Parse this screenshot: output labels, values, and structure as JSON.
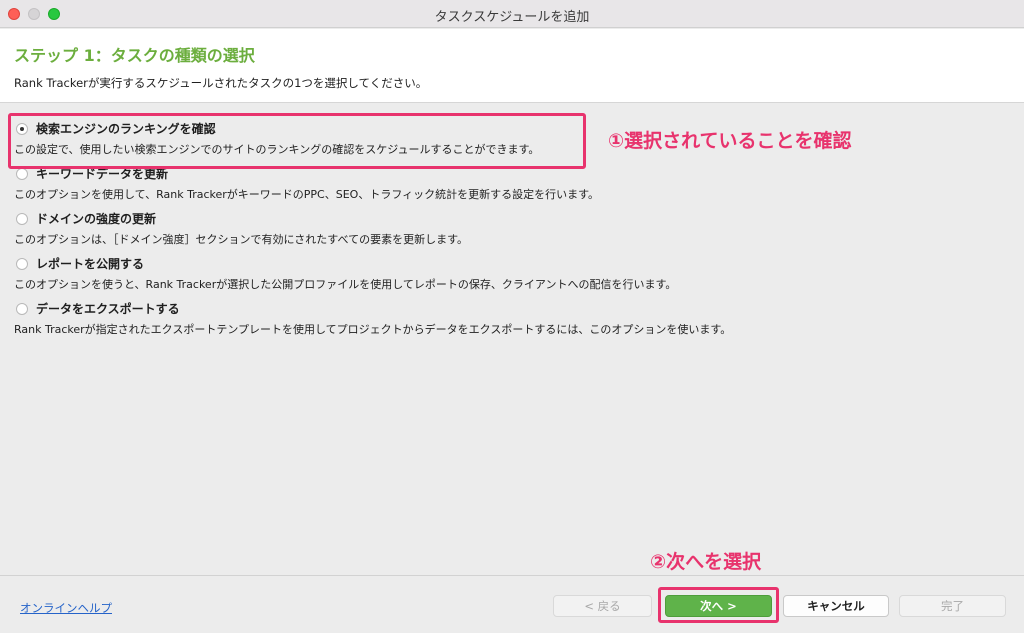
{
  "window": {
    "title": "タスクスケジュールを追加"
  },
  "header": {
    "step_title": "ステップ 1：タスクの種類の選択",
    "description": "Rank Trackerが実行するスケジュールされたタスクの1つを選択してください。"
  },
  "options": [
    {
      "label": "検索エンジンのランキングを確認",
      "description": "この設定で、使用したい検索エンジンでのサイトのランキングの確認をスケジュールすることができます。",
      "selected": true
    },
    {
      "label": "キーワードデータを更新",
      "description": "このオプションを使用して、Rank TrackerがキーワードのPPC、SEO、トラフィック統計を更新する設定を行います。",
      "selected": false
    },
    {
      "label": "ドメインの強度の更新",
      "description": "このオプションは、［ドメイン強度］セクションで有効にされたすべての要素を更新します。",
      "selected": false
    },
    {
      "label": "レポートを公開する",
      "description": "このオプションを使うと、Rank Trackerが選択した公開プロファイルを使用してレポートの保存、クライアントへの配信を行います。",
      "selected": false
    },
    {
      "label": "データをエクスポートする",
      "description": "Rank Trackerが指定されたエクスポートテンプレートを使用してプロジェクトからデータをエクスポートするには、このオプションを使います。",
      "selected": false
    }
  ],
  "annotations": {
    "first": "①選択されていることを確認",
    "second": "②次へを選択"
  },
  "footer": {
    "help_link": "オンラインヘルプ",
    "back_label": "< 戻る",
    "next_label": "次へ >",
    "cancel_label": "キャンセル",
    "finish_label": "完了"
  },
  "colors": {
    "accent_green": "#6cae3e",
    "annotation_pink": "#e8336d",
    "primary_button": "#5fb34a",
    "link_blue": "#2563c9"
  }
}
